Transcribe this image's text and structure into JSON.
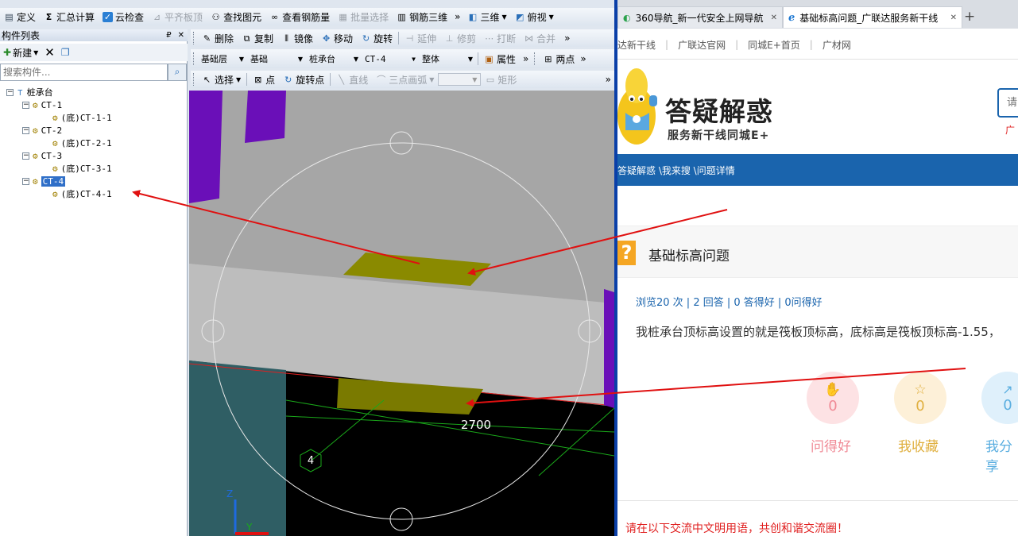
{
  "app": {
    "menu_row": [
      "定义",
      "汇总计算",
      "云检查",
      "平齐板顶",
      "查找图元",
      "查看钢筋量",
      "批量选择",
      "钢筋三维",
      "三维",
      "俯视"
    ],
    "menu_more": "»"
  },
  "component_list": {
    "title": "构件列表",
    "pin": "₽",
    "close": "✕",
    "new_label": "新建",
    "search_placeholder": "搜索构件...",
    "tree": {
      "root": "桩承台",
      "items": [
        {
          "label": "CT-1",
          "child": "(底)CT-1-1"
        },
        {
          "label": "CT-2",
          "child": "(底)CT-2-1"
        },
        {
          "label": "CT-3",
          "child": "(底)CT-3-1"
        },
        {
          "label": "CT-4",
          "child": "(底)CT-4-1"
        }
      ]
    }
  },
  "toolbar": {
    "edit": [
      "删除",
      "复制",
      "镜像",
      "移动",
      "旋转",
      "延伸",
      "修剪",
      "打断",
      "合并"
    ],
    "layer_dd": {
      "floor": "基础层",
      "category": "基础",
      "type": "桩承台",
      "element": "CT-4",
      "scope": "整体"
    },
    "property": "属性",
    "two_point": "两点",
    "draw": [
      "选择",
      "点",
      "旋转点",
      "直线",
      "三点画弧",
      "矩形"
    ],
    "more": "»"
  },
  "viewport": {
    "dimension": "2700",
    "axis_label": "4",
    "axis_z": "Z",
    "axis_y": "Y"
  },
  "browser": {
    "tabs": [
      {
        "title": "360导航_新一代安全上网导航",
        "close": "✕"
      },
      {
        "title": "基础标高问题_广联达服务新干线",
        "close": "✕"
      }
    ],
    "new_tab": "+",
    "nav_links": [
      "达新干线",
      "广联达官网",
      "同城E+首页",
      "广材网"
    ],
    "logo_title": "答疑解惑",
    "logo_sub": "服务新干线同城E+",
    "search_placeholder": "请",
    "side_text": "广",
    "breadcrumb": "答疑解惑 \\我来搜 \\问题详情",
    "question_title": "基础标高问题",
    "stats": "浏览20 次 | 2 回答 | 0 答得好 | 0问得好",
    "body": "我桩承台顶标高设置的就是筏板顶标高，底标高是筏板顶标高-1.55，",
    "actions": [
      {
        "count": "0",
        "label": "问得好",
        "color": "#f08a96"
      },
      {
        "count": "0",
        "label": "我收藏",
        "color": "#e0b040"
      },
      {
        "count": "0",
        "label": "我分享",
        "color": "#5aaee0"
      }
    ],
    "notice": "请在以下交流中文明用语，共创和谐交流圈！"
  },
  "colors": {
    "accent_blue": "#1a64ad",
    "annotation_red": "#e01010",
    "slab_olive": "#8a8a00",
    "column_purple": "#6a0fb8"
  }
}
